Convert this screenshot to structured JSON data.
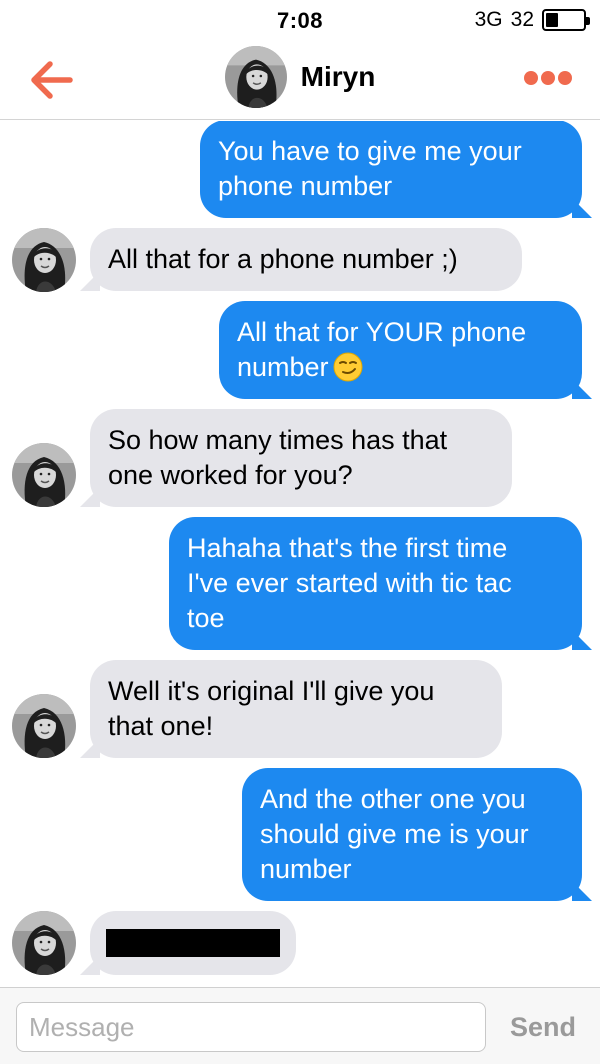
{
  "status_bar": {
    "time": "7:08",
    "network": "3G",
    "signal_count": "32",
    "battery_level": 0.33
  },
  "nav": {
    "back_icon": "back-arrow-icon",
    "title": "Miryn",
    "more_icon": "more-dots-icon",
    "accent_color": "#f06a4e"
  },
  "messages": [
    {
      "direction": "out",
      "lines": [
        "You have to give me your",
        "phone number"
      ]
    },
    {
      "direction": "in",
      "lines": [
        "All that for a phone number ;)"
      ]
    },
    {
      "direction": "out",
      "lines": [
        "All that for YOUR phone",
        "number"
      ],
      "emoji": "smirk-emoji-icon"
    },
    {
      "direction": "in",
      "lines": [
        "So how many times has that",
        "one worked for you?"
      ]
    },
    {
      "direction": "out",
      "lines": [
        "Hahaha that's the first time",
        "I've ever started with tic tac",
        "toe"
      ]
    },
    {
      "direction": "in",
      "lines": [
        "Well it's original I'll give you",
        "that one!"
      ]
    },
    {
      "direction": "out",
      "lines": [
        "And the other one you",
        "should give me is your",
        "number"
      ]
    },
    {
      "direction": "in",
      "lines": [],
      "redacted": true
    }
  ],
  "composer": {
    "placeholder": "Message",
    "value": "",
    "send_label": "Send"
  },
  "colors": {
    "outgoing_bubble": "#1d89f0",
    "incoming_bubble": "#e5e5ea",
    "accent": "#f06a4e"
  }
}
